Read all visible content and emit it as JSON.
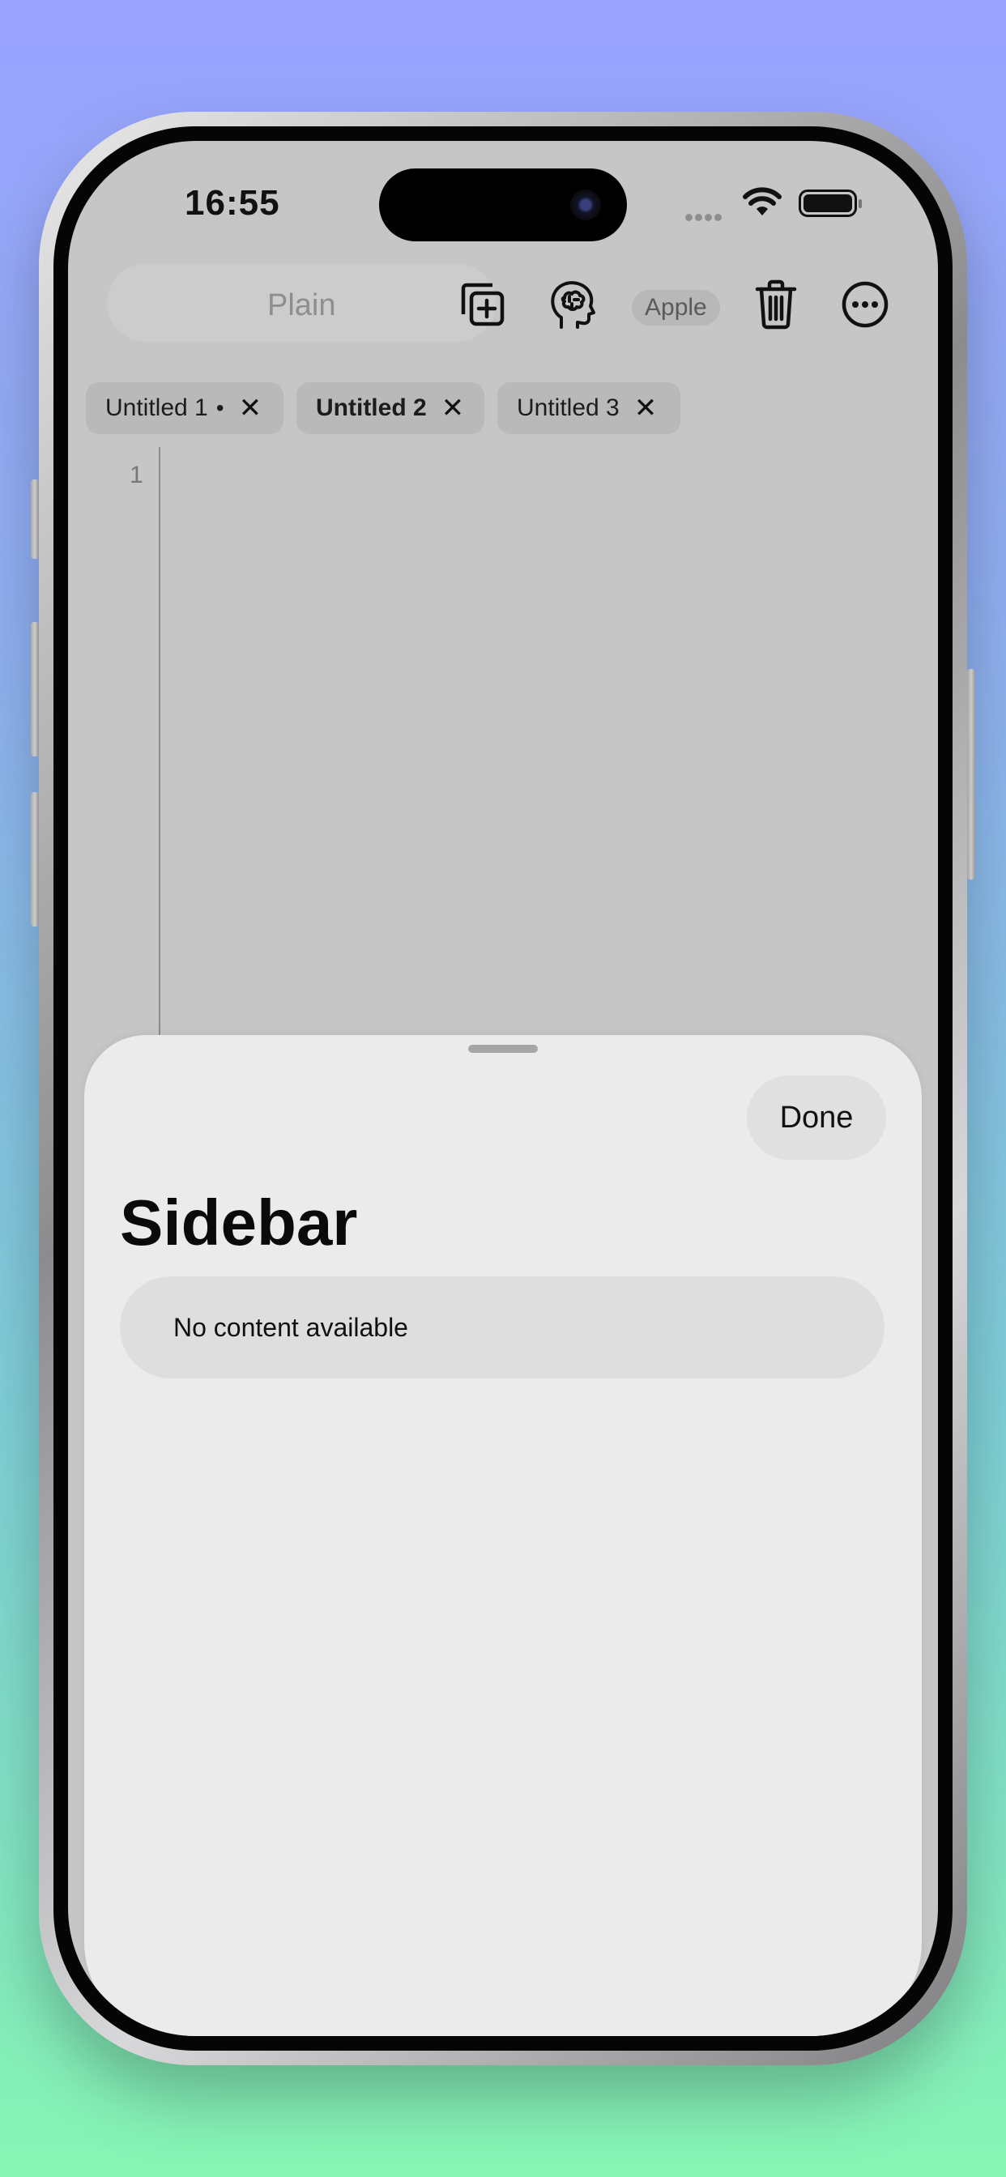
{
  "status_bar": {
    "time": "16:55"
  },
  "toolbar": {
    "mode_label": "Plain",
    "new_file_icon": "plus-square-on-square-icon",
    "ai_icon": "brain-head-icon",
    "model_chip": "Apple",
    "delete_icon": "trash-icon",
    "more_icon": "ellipsis-circle-icon"
  },
  "tabs": [
    {
      "label": "Untitled 1",
      "modified": true,
      "active": false
    },
    {
      "label": "Untitled 2",
      "modified": false,
      "active": true
    },
    {
      "label": "Untitled 3",
      "modified": false,
      "active": false
    }
  ],
  "editor": {
    "line_numbers": [
      "1"
    ]
  },
  "sheet": {
    "done_label": "Done",
    "title": "Sidebar",
    "empty_message": "No content available"
  },
  "colors": {
    "background_top": "#9aa3ff",
    "background_bottom": "#86f5b4",
    "editor_bg": "#c6c6c6",
    "sheet_bg": "#ebebeb"
  }
}
